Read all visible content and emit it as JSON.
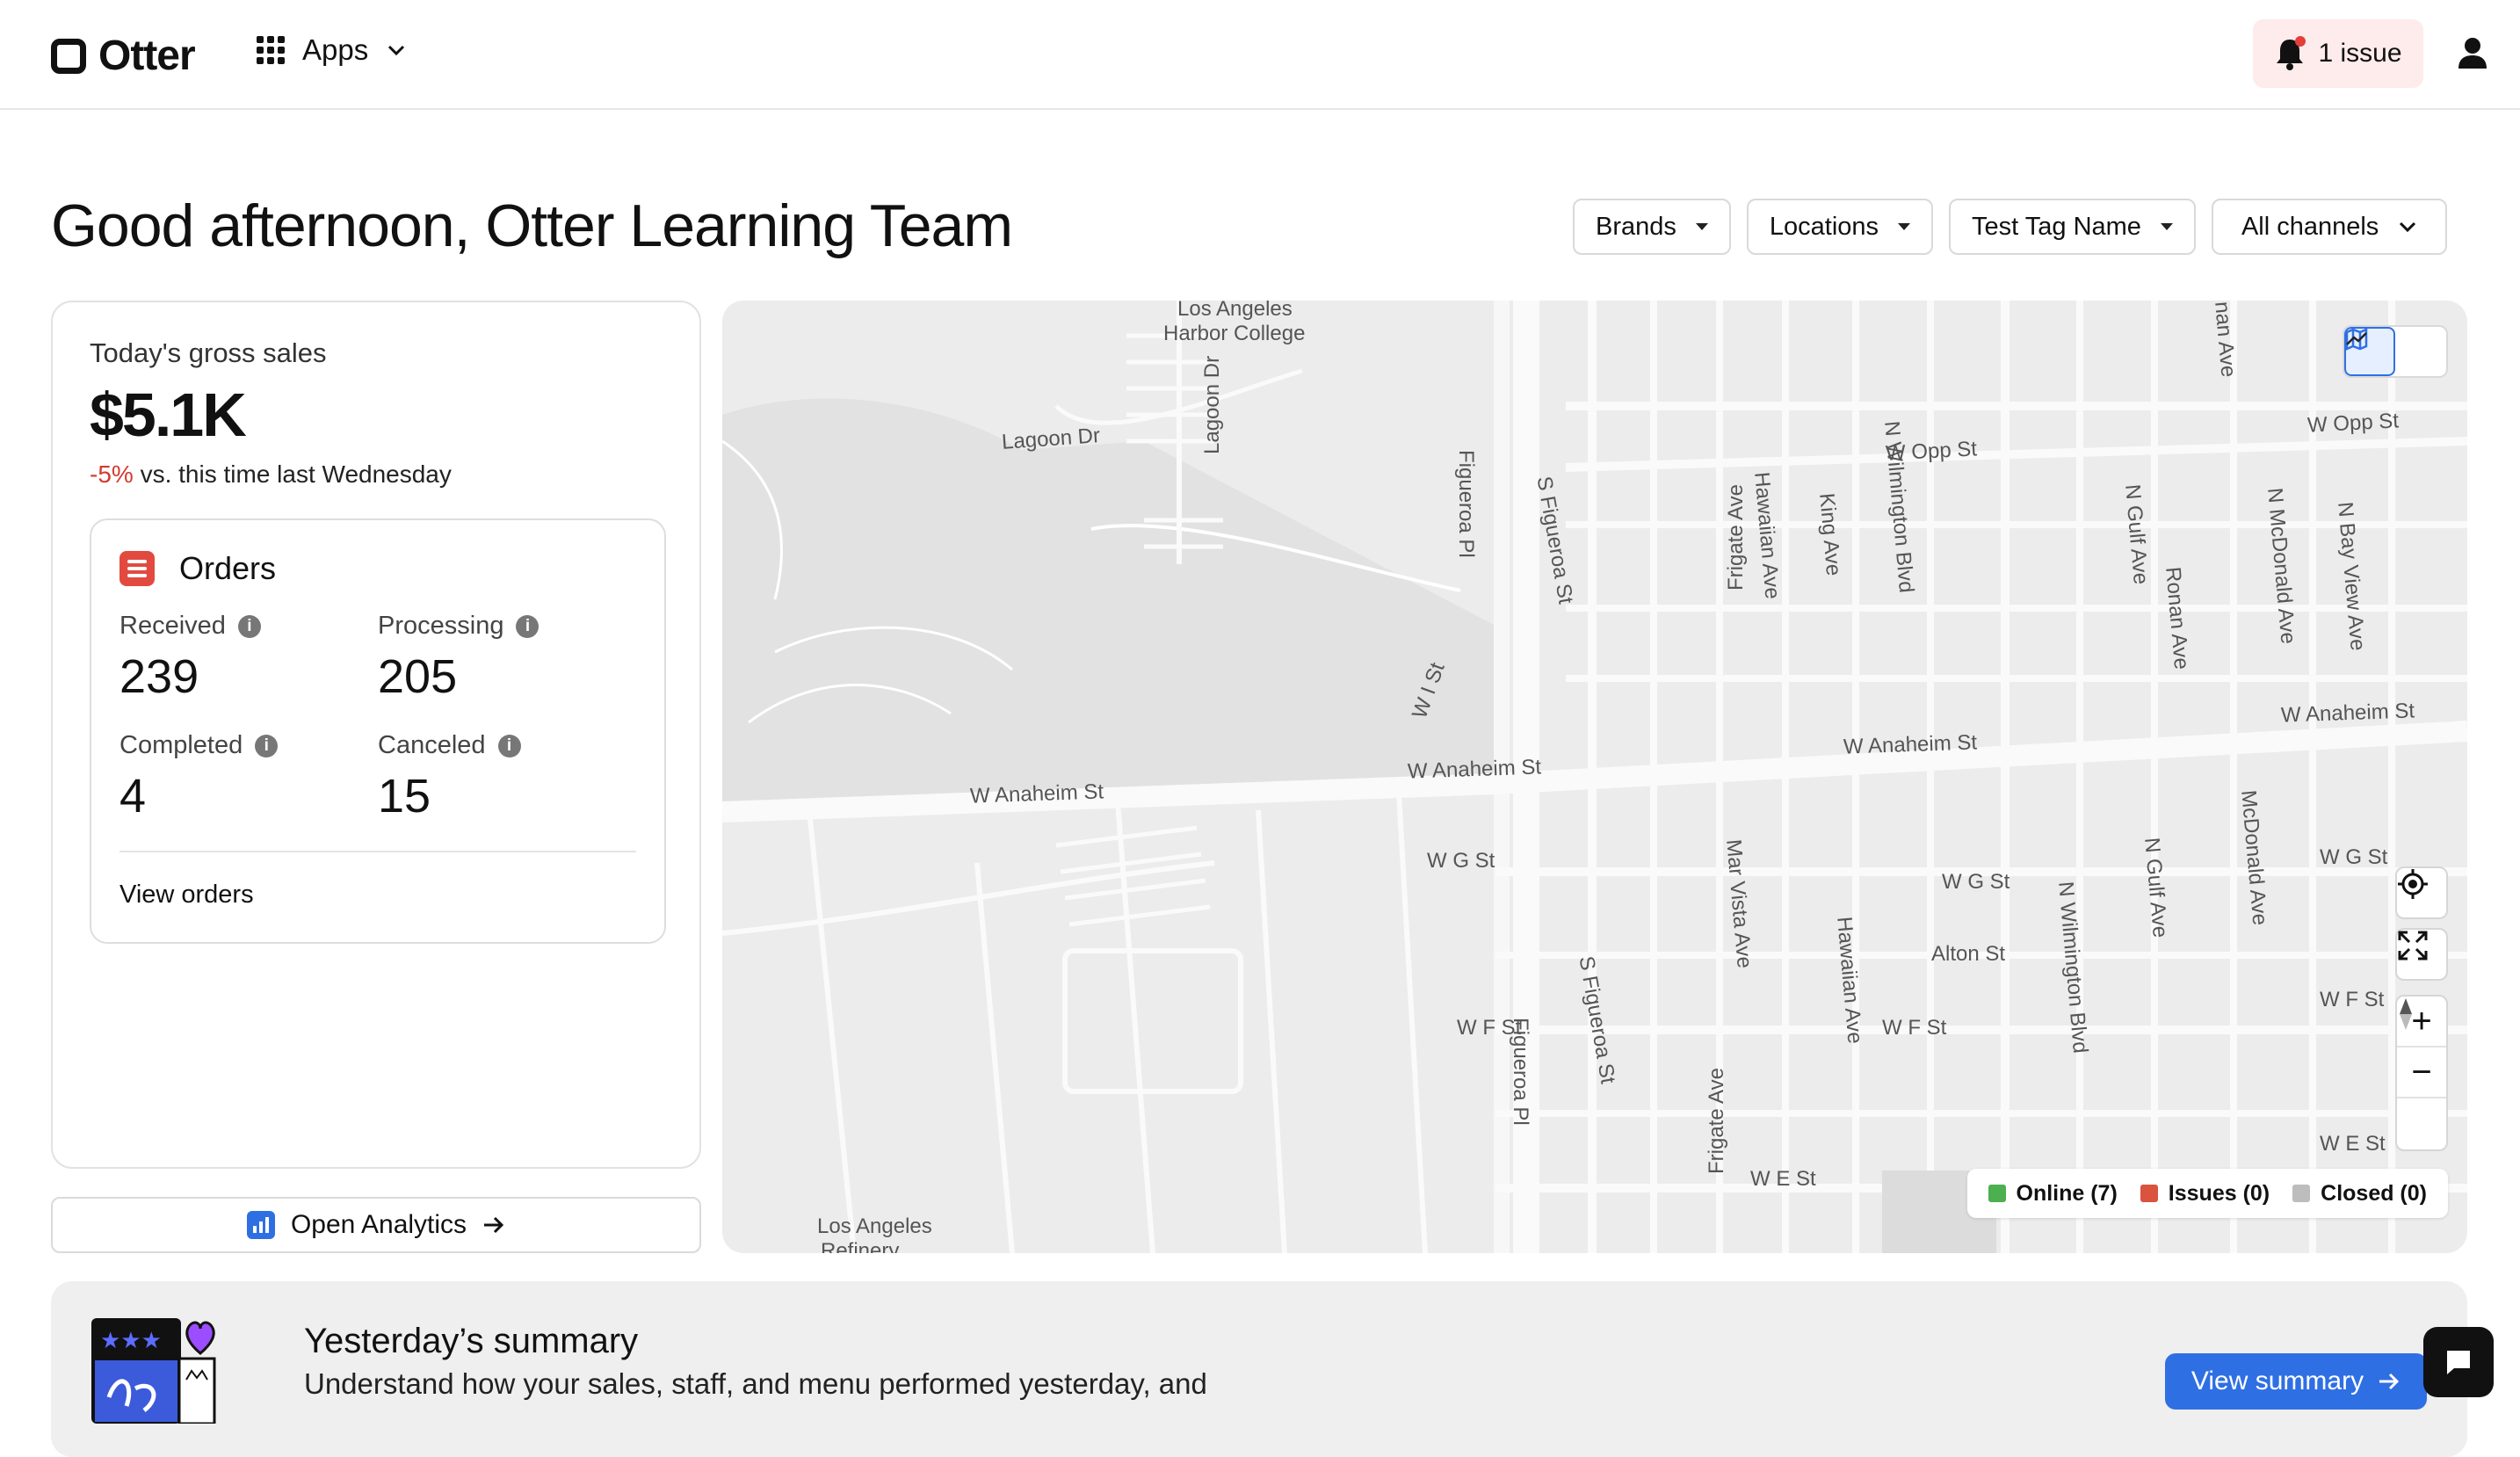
{
  "header": {
    "brand": "Otter",
    "apps_label": "Apps",
    "issue_label": "1 issue"
  },
  "greeting": "Good afternoon, Otter Learning Team",
  "filters": [
    "Brands",
    "Locations",
    "Test Tag Name",
    "All channels"
  ],
  "sales": {
    "label": "Today's gross sales",
    "value": "$5.1K",
    "delta": "-5%",
    "delta_text": "vs. this time last Wednesday"
  },
  "orders": {
    "title": "Orders",
    "received_label": "Received",
    "received_value": "239",
    "processing_label": "Processing",
    "processing_value": "205",
    "completed_label": "Completed",
    "completed_value": "4",
    "canceled_label": "Canceled",
    "canceled_value": "15",
    "view_label": "View orders"
  },
  "analytics_label": "Open Analytics",
  "map": {
    "labels": {
      "harbor_college_1": "Los Angeles",
      "harbor_college_2": "Harbor College",
      "lagoon_dr": "Lagoon Dr",
      "lagoon_dr_v": "Lagoon Dr",
      "w_anaheim_1": "W Anaheim St",
      "w_anaheim_2": "W Anaheim St",
      "w_anaheim_3": "W Anaheim St",
      "w_anaheim_4": "W Anaheim St",
      "w_opp_1": "W Opp St",
      "w_opp_2": "W Opp St",
      "w_g_1": "W G St",
      "w_g_2": "W G St",
      "w_g_3": "W G St",
      "w_f_1": "W F St",
      "w_f_2": "W F St",
      "w_f_3": "W F St",
      "w_e_1": "W E St",
      "w_e_2": "W E St",
      "alton": "Alton St",
      "w_i": "W I St",
      "refinery_1": "Los Angeles",
      "refinery_2": "Refinery",
      "figueroa_pl_1": "Figueroa Pl",
      "figueroa_pl_2": "Figueroa Pl",
      "s_figueroa_1": "S Figueroa St",
      "s_figueroa_2": "S Figueroa St",
      "frigate_1": "Frigate Ave",
      "frigate_2": "Frigate Ave",
      "hawaiian_1": "Hawaiian Ave",
      "hawaiian_2": "Hawaiian Ave",
      "king": "King Ave",
      "n_wilmington_1": "N Wilmington Blvd",
      "n_wilmington_2": "N Wilmington Blvd",
      "n_gulf_1": "N Gulf Ave",
      "n_gulf_2": "N Gulf Ave",
      "ronan": "Ronan Ave",
      "n_mcdonald": "N McDonald Ave",
      "n_bay_view": "N Bay View Ave",
      "mcdonald": "McDonald Ave",
      "mar_vista": "Mar Vista Ave",
      "nan_ave": "nan Ave"
    },
    "legend": {
      "online": "Online (7)",
      "issues": "Issues (0)",
      "closed": "Closed (0)"
    },
    "colors": {
      "online": "#4caf50",
      "issues": "#d9533f",
      "closed": "#bdbdbd"
    }
  },
  "summary": {
    "title": "Yesterday’s summary",
    "description": "Understand how your sales, staff, and menu performed yesterday, and",
    "button": "View summary"
  },
  "colors": {
    "accent": "#2f6fe4",
    "negative": "#d23b30",
    "orders_icon": "#e24a40"
  }
}
